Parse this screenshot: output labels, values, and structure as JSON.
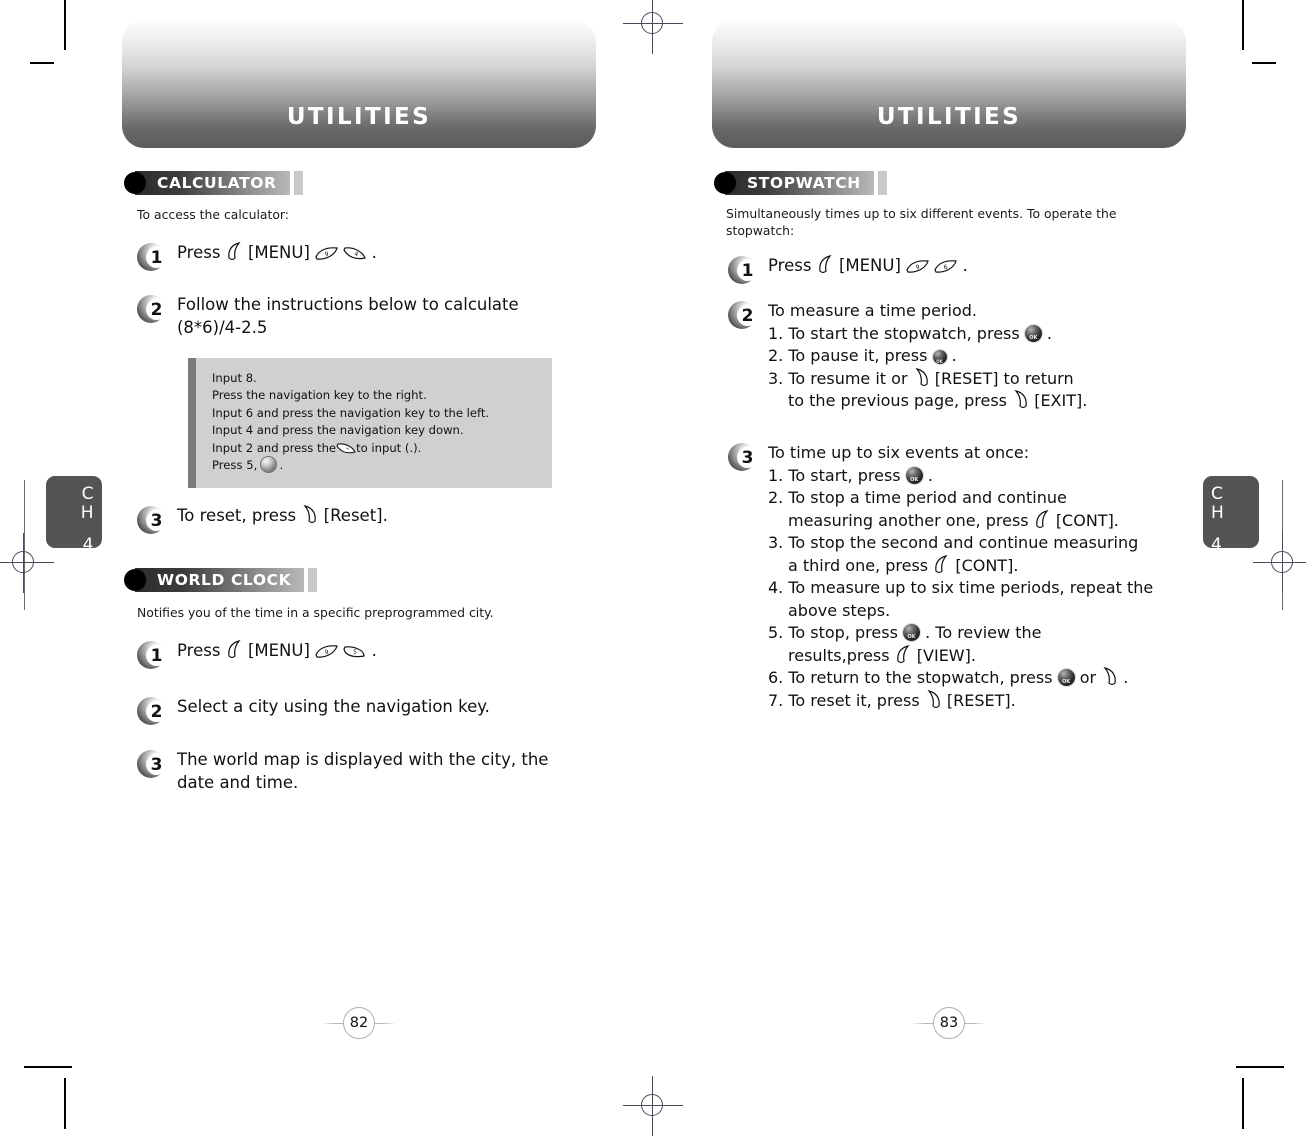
{
  "document": {
    "left_page": {
      "banner_title": "UTILITIES",
      "chapter_tab": {
        "ch": "C",
        "ch2": "H",
        "num": "4"
      },
      "page_number": "82",
      "sections": [
        {
          "badge": "CALCULATOR",
          "intro": "To access the calculator:",
          "steps": [
            {
              "num": "1",
              "text_before": "Press",
              "text_after": "[MENU]",
              "keys": [
                "softkey-left",
                "key-9",
                "key-4"
              ],
              "tail": "."
            },
            {
              "num": "2",
              "line1": "Follow the instructions below to calculate",
              "line2": "(8*6)/4-2.5"
            },
            {
              "num": "3",
              "text": "To reset, press",
              "key": "softkey-right",
              "label": "[Reset]."
            }
          ],
          "example_box": {
            "lines": [
              "Input 8.",
              "Press the navigation key to the right.",
              "Input 6 and press the navigation key to the left.",
              "Input 4 and press the navigation key down.",
              "Input 2 and press the",
              "to input (.).",
              "Press 5,",
              "."
            ]
          }
        },
        {
          "badge": "WORLD CLOCK",
          "intro": "Notifies you of the time in a specific preprogrammed city.",
          "steps": [
            {
              "num": "1",
              "text_before": "Press",
              "text_after": "[MENU]",
              "keys": [
                "softkey-left",
                "key-9",
                "key-5"
              ],
              "tail": "."
            },
            {
              "num": "2",
              "text": "Select a city using the navigation key."
            },
            {
              "num": "3",
              "line1": "The world map is displayed with the city, the",
              "line2": "date and time."
            }
          ]
        }
      ]
    },
    "right_page": {
      "banner_title": "UTILITIES",
      "chapter_tab": {
        "ch": "C",
        "ch2": "H",
        "num": "4"
      },
      "page_number": "83",
      "sections": [
        {
          "badge": "STOPWATCH",
          "intro_line1": "Simultaneously times up to six different events. To operate the",
          "intro_line2": "stopwatch:",
          "steps": [
            {
              "num": "1",
              "text_before": "Press",
              "text_after": "[MENU]",
              "keys": [
                "softkey-left",
                "key-9",
                "key-6"
              ],
              "tail": "."
            },
            {
              "num": "2",
              "heading": "To measure a time period.",
              "items": [
                {
                  "pre": "1. To start the stopwatch, press",
                  "key": "ok",
                  "post": "."
                },
                {
                  "pre": "2. To pause it, press",
                  "key": "nav",
                  "post": "."
                },
                {
                  "pre": "3. To resume it or",
                  "key": "softkey-right",
                  "post": "[RESET] to return"
                },
                {
                  "pre": "to the previous page, press",
                  "key": "softkey-right",
                  "post": "[EXIT].",
                  "indent": true
                }
              ]
            },
            {
              "num": "3",
              "heading": "To time up to six events at once:",
              "items": [
                {
                  "pre": "1. To start, press",
                  "key": "ok",
                  "post": "."
                },
                {
                  "pre": "2. To stop a time period and continue",
                  "key": "",
                  "post": ""
                },
                {
                  "pre": "measuring another one, press",
                  "key": "softkey-left",
                  "post": "[CONT].",
                  "indent": true
                },
                {
                  "pre": "3. To stop the second and continue measuring",
                  "key": "",
                  "post": ""
                },
                {
                  "pre": "a third one, press",
                  "key": "softkey-left",
                  "post": "[CONT].",
                  "indent": true
                },
                {
                  "pre": "4. To measure up to six time periods, repeat the",
                  "key": "",
                  "post": ""
                },
                {
                  "pre": "above steps.",
                  "key": "",
                  "post": "",
                  "indent": true
                },
                {
                  "pre": "5. To stop, press",
                  "key": "ok",
                  "post": ". To review the"
                },
                {
                  "pre": "results,press",
                  "key": "softkey-left",
                  "post": "[VIEW].",
                  "indent": true
                },
                {
                  "pre": "6. To return to the stopwatch, press",
                  "key": "ok",
                  "post": "or",
                  "key2": "softkey-right",
                  "post2": "."
                },
                {
                  "pre": "7. To reset it, press",
                  "key": "softkey-right",
                  "post": "[RESET]."
                }
              ]
            }
          ]
        }
      ]
    },
    "colors": {
      "banner_dark": "#5a5a5a",
      "badge_dark": "#2b2b2b",
      "chapter_tab_bg": "#545454",
      "example_box_bg": "#d0d0d0",
      "example_box_bar": "#7a7a7a"
    }
  }
}
